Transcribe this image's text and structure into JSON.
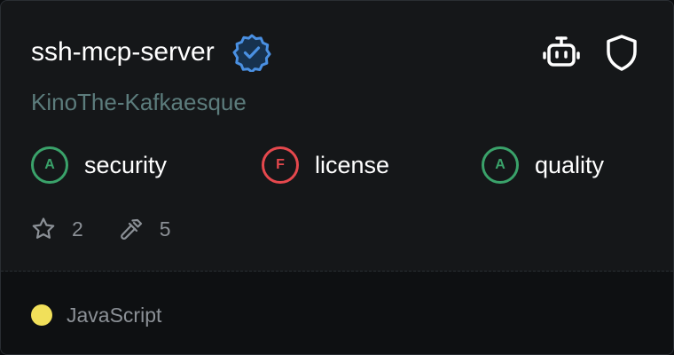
{
  "server": {
    "name": "ssh-mcp-server",
    "owner": "KinoThe-Kafkaesque",
    "verified_icon": "verified-badge-icon",
    "accent_color": "#4a90e2"
  },
  "actions": [
    {
      "icon": "robot-icon"
    },
    {
      "icon": "shield-icon"
    }
  ],
  "grades": [
    {
      "grade": "A",
      "label": "security",
      "color": "#3aa26a"
    },
    {
      "grade": "F",
      "label": "license",
      "color": "#e5484d"
    },
    {
      "grade": "A",
      "label": "quality",
      "color": "#3aa26a"
    }
  ],
  "stats": {
    "stars": "2",
    "stars_icon": "star-icon",
    "tools": "5",
    "tools_icon": "hammer-icon"
  },
  "language": {
    "name": "JavaScript",
    "color": "#f1e05a"
  }
}
